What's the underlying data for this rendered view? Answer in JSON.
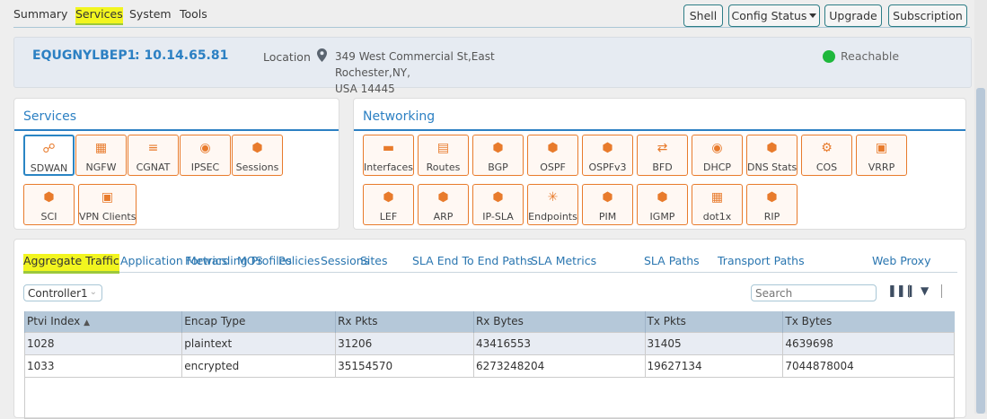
{
  "topnav": {
    "tabs": [
      "Summary",
      "Services",
      "System",
      "Tools"
    ],
    "active": "Services",
    "buttons": {
      "shell": "Shell",
      "config_status": "Config Status",
      "upgrade": "Upgrade",
      "subscription": "Subscription"
    }
  },
  "device": {
    "name": "EQUGNYLBEP1",
    "ip": ": 10.14.65.81",
    "location_label": "Location",
    "address_line1": "349 West Commercial St,East Rochester,NY,",
    "address_line2": "USA 14445",
    "status": "Reachable",
    "status_color": "#1fb83c"
  },
  "services": {
    "title": "Services",
    "items": [
      "SDWAN",
      "NGFW",
      "CGNAT",
      "IPSEC",
      "Sessions",
      "SCI",
      "VPN Clients"
    ]
  },
  "networking": {
    "title": "Networking",
    "items": [
      "Interfaces",
      "Routes",
      "BGP",
      "OSPF",
      "OSPFv3",
      "BFD",
      "DHCP",
      "DNS Stats",
      "COS",
      "VRRP",
      "LEF",
      "ARP",
      "IP-SLA",
      "Endpoints",
      "PIM",
      "IGMP",
      "dot1x",
      "RIP"
    ]
  },
  "subtabs": [
    "Aggregate Traffic",
    "Application Metrics",
    "Forwarding Profiles",
    "MOS",
    "Policies",
    "Sessions",
    "Sites",
    "SLA End To End Paths",
    "SLA Metrics",
    "SLA Paths",
    "Transport Paths",
    "Web Proxy"
  ],
  "controller": "Controller1",
  "search_placeholder": "Search",
  "table": {
    "columns": [
      "Ptvi Index",
      "Encap Type",
      "Rx Pkts",
      "Rx Bytes",
      "Tx Pkts",
      "Tx Bytes"
    ],
    "rows": [
      [
        "1028",
        "plaintext",
        "31206",
        "43416553",
        "31405",
        "4639698"
      ],
      [
        "1033",
        "encrypted",
        "35154570",
        "6273248204",
        "19627134",
        "7044878004"
      ]
    ]
  },
  "colors": {
    "accent": "#2c80c3",
    "tile_border": "#e87b2c",
    "highlight": "#f2f51f"
  }
}
